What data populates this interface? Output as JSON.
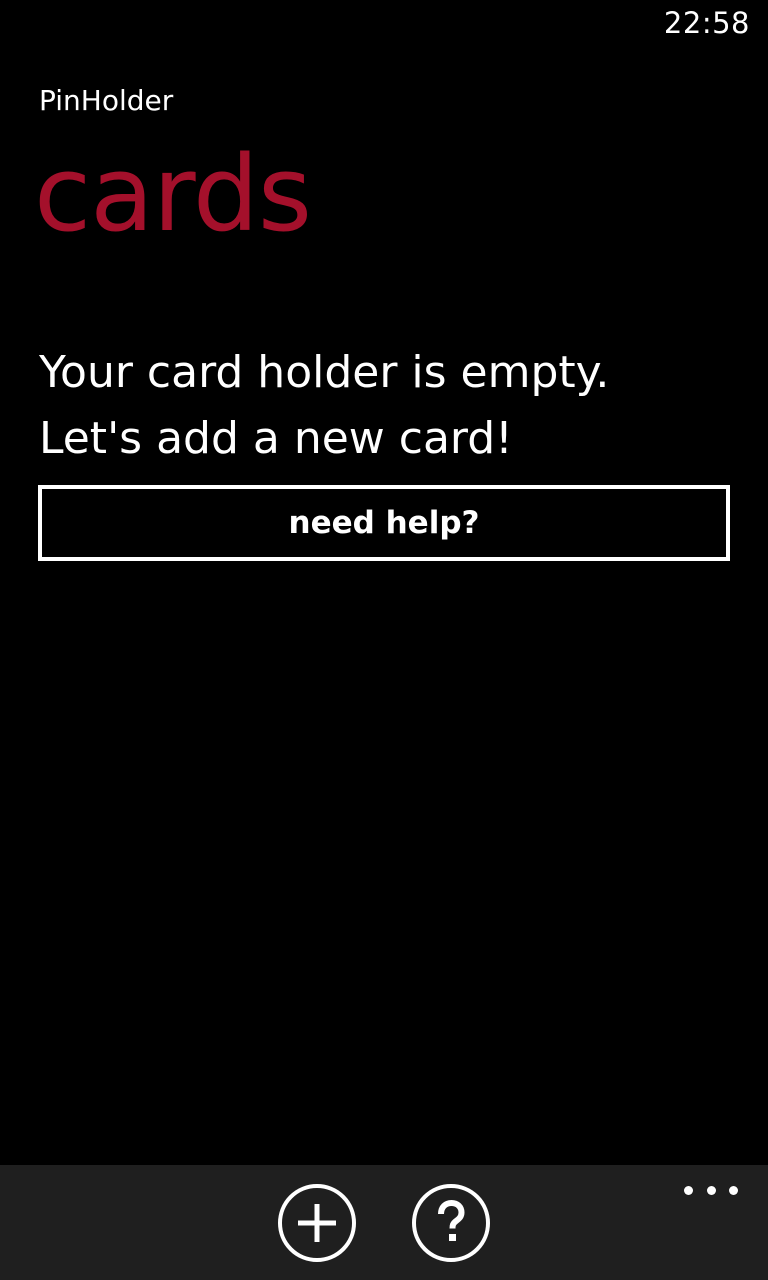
{
  "status_bar": {
    "time": "22:58"
  },
  "header": {
    "app_title": "PinHolder",
    "page_title": "cards"
  },
  "main": {
    "empty_message": [
      "Your card holder is empty.",
      "Let's add a new card!"
    ],
    "help_button_label": "need help?"
  },
  "app_bar": {
    "buttons": [
      {
        "icon": "add-icon"
      },
      {
        "icon": "help-icon"
      }
    ],
    "more_icon": "ellipsis-icon"
  },
  "colors": {
    "accent": "#a4102b",
    "background": "#000000",
    "app_bar": "#1f1f1f",
    "foreground": "#ffffff"
  }
}
